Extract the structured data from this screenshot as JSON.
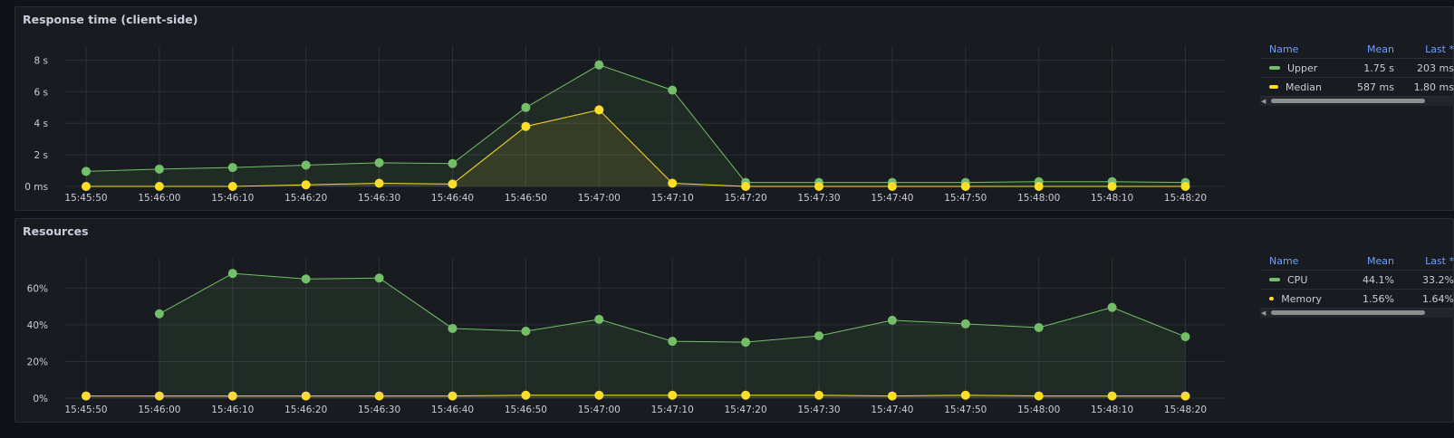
{
  "colors": {
    "upper": "#73bf69",
    "median": "#fade2a",
    "grid": "#2c3036",
    "text": "#ccccdc",
    "header": "#6e9fff"
  },
  "x_labels": [
    "15:45:50",
    "15:46:00",
    "15:46:10",
    "15:46:20",
    "15:46:30",
    "15:46:40",
    "15:46:50",
    "15:47:00",
    "15:47:10",
    "15:47:20",
    "15:47:30",
    "15:47:40",
    "15:47:50",
    "15:48:00",
    "15:48:10",
    "15:48:20"
  ],
  "panels": [
    {
      "title": "Response time (client-side)",
      "legend": {
        "headers": {
          "name": "Name",
          "mean": "Mean",
          "last": "Last *"
        },
        "rows": [
          {
            "name": "Upper",
            "mean": "1.75 s",
            "last": "203 ms",
            "color": "#73bf69"
          },
          {
            "name": "Median",
            "mean": "587 ms",
            "last": "1.80 ms",
            "color": "#fade2a"
          }
        ]
      },
      "chart_data": {
        "type": "line",
        "x": [
          "15:45:50",
          "15:46:00",
          "15:46:10",
          "15:46:20",
          "15:46:30",
          "15:46:40",
          "15:46:50",
          "15:47:00",
          "15:47:10",
          "15:47:20",
          "15:47:30",
          "15:47:40",
          "15:47:50",
          "15:48:00",
          "15:48:10",
          "15:48:20"
        ],
        "y_ticks": [
          "0 ms",
          "2 s",
          "4 s",
          "6 s",
          "8 s"
        ],
        "y_tick_values": [
          0,
          2,
          4,
          6,
          8
        ],
        "ylim": [
          0,
          8.6
        ],
        "unit": "s",
        "series": [
          {
            "name": "Upper",
            "color": "#73bf69",
            "values": [
              0.95,
              1.1,
              1.2,
              1.35,
              1.5,
              1.45,
              5.0,
              7.7,
              6.1,
              0.25,
              0.25,
              0.25,
              0.25,
              0.3,
              0.3,
              0.25
            ]
          },
          {
            "name": "Median",
            "color": "#fade2a",
            "values": [
              0.0,
              0.0,
              0.0,
              0.1,
              0.2,
              0.15,
              3.8,
              4.85,
              0.2,
              0.0,
              0.0,
              0.0,
              0.0,
              0.0,
              0.0,
              0.0
            ]
          }
        ]
      }
    },
    {
      "title": "Resources",
      "legend": {
        "headers": {
          "name": "Name",
          "mean": "Mean",
          "last": "Last *"
        },
        "rows": [
          {
            "name": "CPU",
            "mean": "44.1%",
            "last": "33.2%",
            "color": "#73bf69"
          },
          {
            "name": "Memory",
            "mean": "1.56%",
            "last": "1.64%",
            "color": "#fade2a"
          }
        ]
      },
      "chart_data": {
        "type": "line",
        "x": [
          "15:45:50",
          "15:46:00",
          "15:46:10",
          "15:46:20",
          "15:46:30",
          "15:46:40",
          "15:46:50",
          "15:47:00",
          "15:47:10",
          "15:47:20",
          "15:47:30",
          "15:47:40",
          "15:47:50",
          "15:48:00",
          "15:48:10",
          "15:48:20"
        ],
        "y_ticks": [
          "0%",
          "20%",
          "40%",
          "60%"
        ],
        "y_tick_values": [
          0,
          20,
          40,
          60
        ],
        "ylim": [
          0,
          74
        ],
        "unit": "%",
        "series": [
          {
            "name": "CPU",
            "color": "#73bf69",
            "values": [
              null,
              46,
              68,
              65,
              65.5,
              38,
              36.5,
              43,
              31,
              30.5,
              34,
              42.5,
              40.5,
              38.5,
              49.5,
              33.5
            ]
          },
          {
            "name": "Memory",
            "color": "#fade2a",
            "values": [
              1.2,
              1.2,
              1.2,
              1.2,
              1.2,
              1.2,
              1.6,
              1.6,
              1.6,
              1.6,
              1.6,
              1.2,
              1.6,
              1.2,
              1.2,
              1.2
            ]
          }
        ]
      }
    }
  ]
}
